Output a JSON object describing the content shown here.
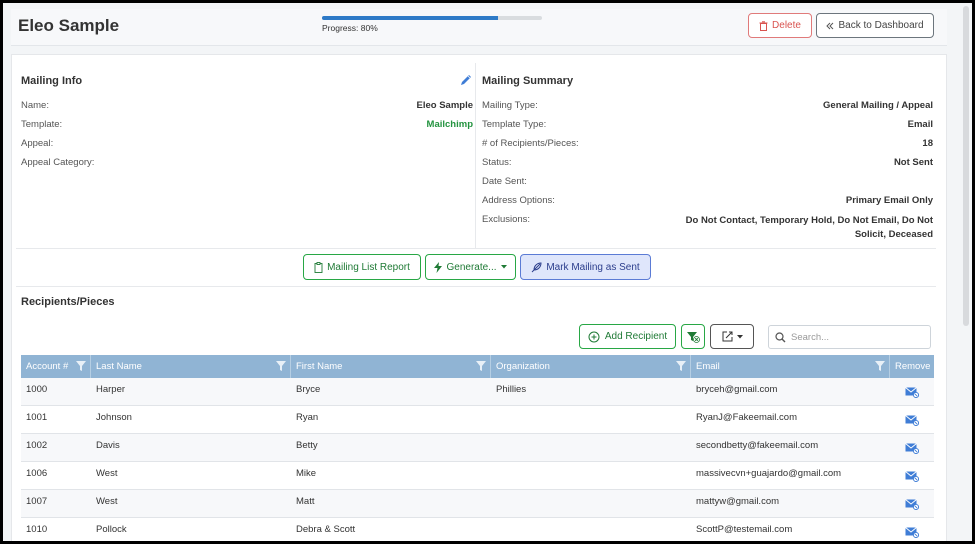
{
  "header": {
    "title": "Eleo Sample",
    "progress_label": "Progress: 80%",
    "progress_value": 0.8,
    "delete_label": "Delete",
    "back_label": "Back to Dashboard"
  },
  "mailing_info": {
    "title": "Mailing Info",
    "fields": [
      {
        "label": "Name:",
        "value": "Eleo Sample"
      },
      {
        "label": "Template:",
        "value": "Mailchimp"
      },
      {
        "label": "Appeal:",
        "value": ""
      },
      {
        "label": "Appeal Category:",
        "value": ""
      }
    ]
  },
  "mailing_summary": {
    "title": "Mailing Summary",
    "fields": [
      {
        "label": "Mailing Type:",
        "value": "General Mailing / Appeal"
      },
      {
        "label": "Template Type:",
        "value": "Email"
      },
      {
        "label": "# of Recipients/Pieces:",
        "value": "18"
      },
      {
        "label": "Status:",
        "value": "Not Sent"
      },
      {
        "label": "Date Sent:",
        "value": ""
      },
      {
        "label": "Address Options:",
        "value": "Primary Email Only"
      },
      {
        "label": "Exclusions:",
        "value": "Do Not Contact, Temporary Hold, Do Not Email, Do Not Solicit, Deceased"
      }
    ]
  },
  "actions": {
    "report_label": "Mailing List Report",
    "generate_label": "Generate...",
    "mark_label": "Mark Mailing as Sent"
  },
  "recipients": {
    "title": "Recipients/Pieces",
    "add_label": "Add Recipient",
    "search_placeholder": "Search...",
    "columns": [
      "Account #",
      "Last Name",
      "First Name",
      "Organization",
      "Email",
      "Remove"
    ],
    "rows": [
      {
        "account": "1000",
        "last": "Harper",
        "first": "Bryce",
        "org": "Phillies",
        "email": "bryceh@gmail.com"
      },
      {
        "account": "1001",
        "last": "Johnson",
        "first": "Ryan",
        "org": "",
        "email": "RyanJ@Fakeemail.com"
      },
      {
        "account": "1002",
        "last": "Davis",
        "first": "Betty",
        "org": "",
        "email": "secondbetty@fakeemail.com"
      },
      {
        "account": "1006",
        "last": "West",
        "first": "Mike",
        "org": "",
        "email": "massivecvn+guajardo@gmail.com"
      },
      {
        "account": "1007",
        "last": "West",
        "first": "Matt",
        "org": "",
        "email": "mattyw@gmail.com"
      },
      {
        "account": "1010",
        "last": "Pollock",
        "first": "Debra & Scott",
        "org": "",
        "email": "ScottP@testemail.com"
      }
    ]
  },
  "colors": {
    "accent_blue": "#2e7ac7",
    "grid_header": "#90b4d4",
    "success_green": "#28a745",
    "danger_red": "#d9534f"
  },
  "icons": [
    "trash-icon",
    "double-chevron-left-icon",
    "pencil-icon",
    "clipboard-icon",
    "bolt-icon",
    "caret-down-icon",
    "feather-icon",
    "plus-circle-icon",
    "filter-clear-icon",
    "export-icon",
    "search-icon",
    "column-filter-icon",
    "remove-mail-icon"
  ]
}
